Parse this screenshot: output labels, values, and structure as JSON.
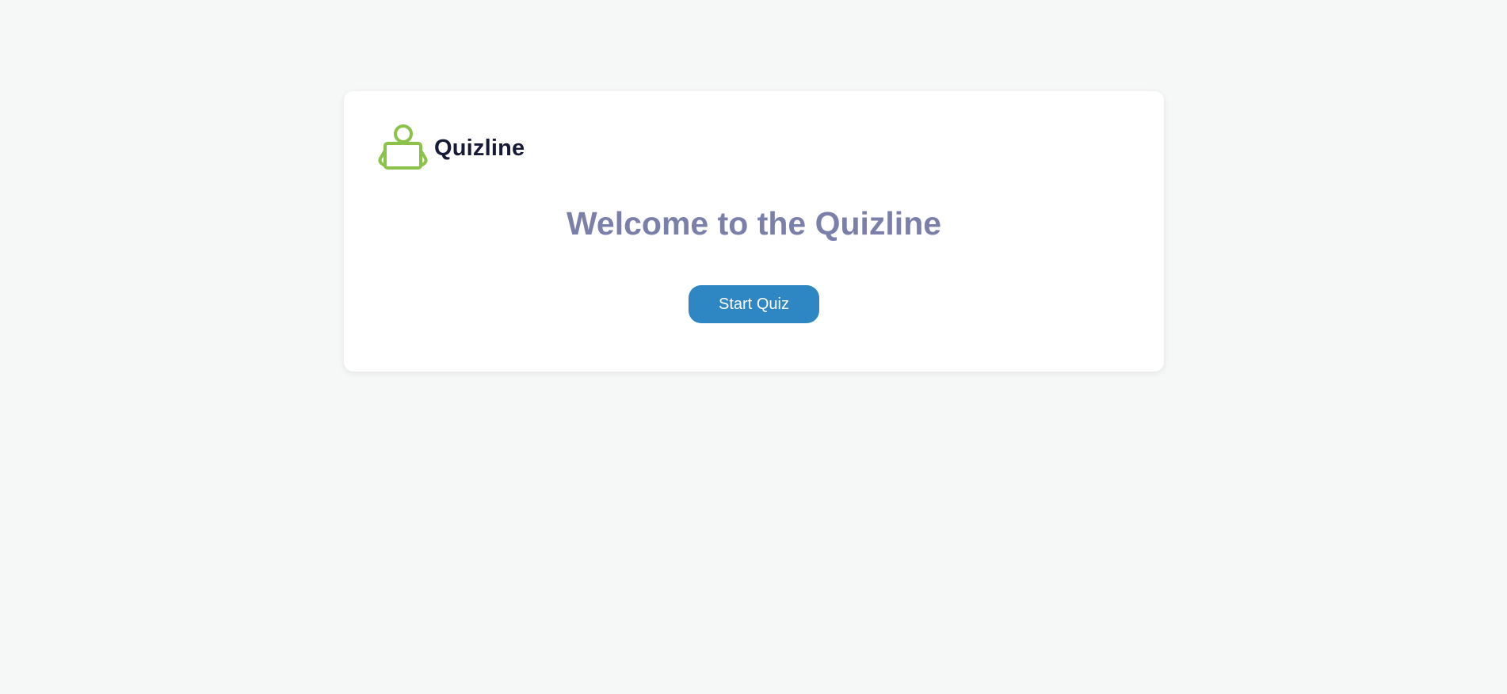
{
  "brand": {
    "name": "Quizline",
    "logo_icon": "person-at-laptop-icon",
    "logo_color": "#8bc34a"
  },
  "main": {
    "heading": "Welcome to the Quizline",
    "start_button_label": "Start Quiz"
  },
  "colors": {
    "background": "#f6f7f7",
    "card": "#ffffff",
    "heading": "#7b80aa",
    "brand_text": "#161a36",
    "button": "#2e87c3"
  }
}
